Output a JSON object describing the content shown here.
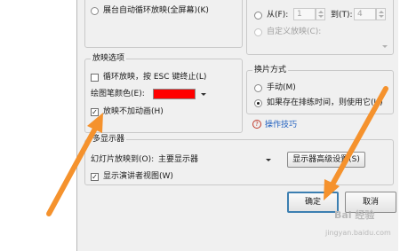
{
  "show_type": {
    "kiosk_label": "展台自动循环放映(全屏幕)(K)"
  },
  "slides": {
    "from_label": "从(F):",
    "from_value": "1",
    "to_label": "到(T):",
    "to_value": "4",
    "custom_label": "自定义放映(C):"
  },
  "show_options": {
    "legend": "放映选项",
    "loop_label": "循环放映，按 ESC 键终止(L)",
    "pen_color_label": "绘图笔颜色(E):",
    "pen_color": "#ff0000",
    "no_animation_label": "放映不加动画(H)",
    "loop_checked": false,
    "no_animation_checked": true
  },
  "advance": {
    "legend": "换片方式",
    "manual_label": "手动(M)",
    "timings_label": "如果存在排练时间，则使用它(U)",
    "selected": "timings"
  },
  "tips_link": "操作技巧",
  "monitors": {
    "legend": "多显示器",
    "show_on_label": "幻灯片放映到(O):",
    "show_on_value": "主要显示器",
    "advanced_button": "显示器高级设置(S)",
    "presenter_view_label": "显示演讲者视图(W)",
    "presenter_view_checked": true
  },
  "footer": {
    "ok_label": "确定",
    "cancel_label": "取消"
  },
  "watermark": "Bai 经验",
  "watermark_url": "jingyan.baidu.com",
  "colors": {
    "arrow": "#f5922d",
    "link": "#1f5fbf",
    "dialog_bg": "#f0f0f0"
  }
}
